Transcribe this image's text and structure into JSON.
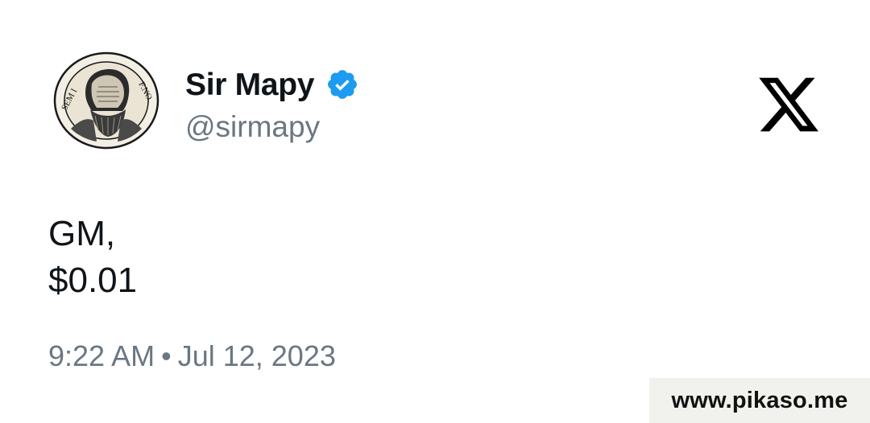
{
  "profile": {
    "display_name": "Sir Mapy",
    "handle": "@sirmapy",
    "avatar_icon": "engraved-portrait-medallion",
    "avatar_inscription_left": "SEM I",
    "avatar_inscription_right": "F.NO.",
    "verified_icon": "verified-badge-icon",
    "verified_color": "#1d9bf0"
  },
  "brand": {
    "logo_icon": "x-logo-icon"
  },
  "tweet": {
    "lines": [
      "GM,",
      "$0.01"
    ],
    "time": "9:22 AM",
    "separator": "•",
    "date": "Jul 12, 2023"
  },
  "watermark": {
    "text": "www.pikaso.me"
  },
  "colors": {
    "text_primary": "#0f1419",
    "text_secondary": "#6b7782",
    "watermark_bg": "#f1f1ee"
  }
}
